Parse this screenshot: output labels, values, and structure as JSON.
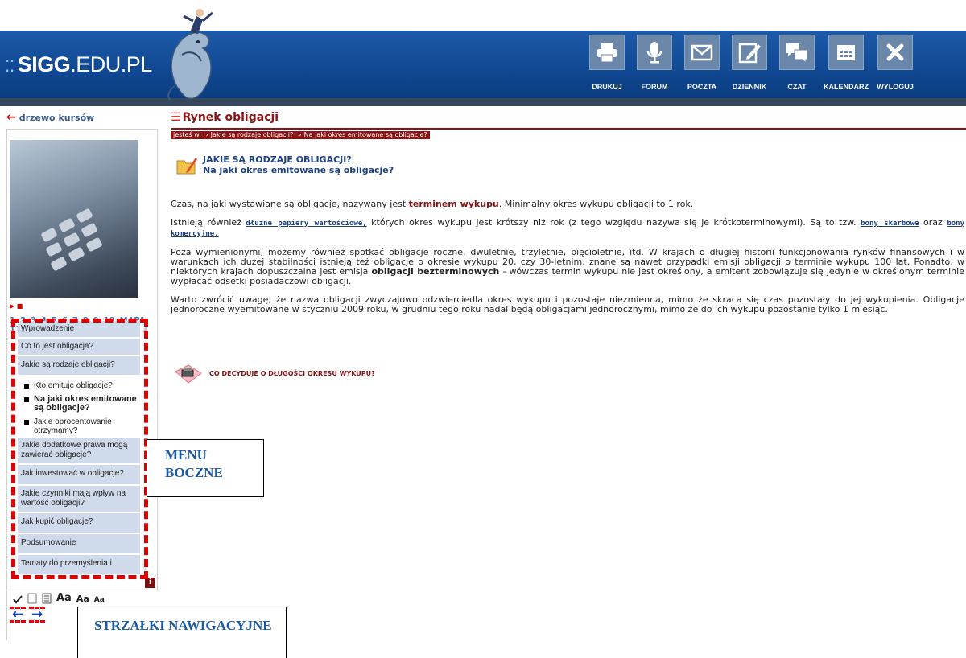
{
  "header": {
    "logo_text_bold": "SIGG",
    "logo_text_rest": ".EDU.PL",
    "nav": [
      {
        "label": "DRUKUJ",
        "icon": "printer-icon"
      },
      {
        "label": "FORUM",
        "icon": "microphone-icon"
      },
      {
        "label": "POCZTA",
        "icon": "mail-icon"
      },
      {
        "label": "DZIENNIK",
        "icon": "journal-edit-icon"
      },
      {
        "label": "CZAT",
        "icon": "chat-icon"
      },
      {
        "label": "KALENDARZ",
        "icon": "calendar-icon"
      },
      {
        "label": "WYLOGUJ",
        "icon": "close-icon"
      }
    ]
  },
  "sidebar": {
    "back_label": "drzewo kursów",
    "page_numbers": [
      "1",
      "2",
      "3",
      "4",
      "5",
      "6",
      "7",
      "8",
      "9",
      "10",
      "MAPA",
      "11"
    ],
    "menu": [
      {
        "label": "Wprowadzenie",
        "type": "item"
      },
      {
        "label": "Co to jest obligacja?",
        "type": "item"
      },
      {
        "label": "Jakie są rodzaje obligacji?",
        "type": "item"
      },
      {
        "label": "Kto emituje obligacje?",
        "type": "sub"
      },
      {
        "label": "Na jaki okres emitowane są obligacje?",
        "type": "sub-active"
      },
      {
        "label": "Jakie oprocentowanie otrzymamy?",
        "type": "sub"
      },
      {
        "label": "Jakie dodatkowe prawa mogą zawierać obligacje?",
        "type": "item"
      },
      {
        "label": "Jak inwestować w obligacje?",
        "type": "item"
      },
      {
        "label": "Jakie czynniki mają wpływ na wartość obligacji?",
        "type": "item"
      },
      {
        "label": "Jak kupić obligacje?",
        "type": "item"
      },
      {
        "label": "Podsumowanie",
        "type": "item"
      },
      {
        "label": "Tematy do przemyślenia i",
        "type": "item"
      }
    ],
    "font_sizes": [
      "Aa",
      "Aa",
      "Aa"
    ],
    "arrow_prev": "←",
    "arrow_next": "→"
  },
  "callouts": {
    "menu": "MENU BOCZNE",
    "arrows": "STRZAŁKI NAWIGACYJNE"
  },
  "main": {
    "title": "Rynek obligacji",
    "breadcrumb_prefix": "jesteś w:",
    "breadcrumb_1": "Jakie są rodzaje obligacji?",
    "breadcrumb_2": "Na jaki okres emitowane są obligacje?",
    "lesson_title_1": "JAKIE SĄ RODZAJE OBLIGACJI?",
    "lesson_title_2": "Na jaki okres emitowane są obligacje?",
    "p1_a": "Czas, na jaki wystawiane są obligacje, nazywany jest ",
    "p1_term": "terminem wykupu",
    "p1_b": ". Minimalny okres wykupu obligacji to 1 rok.",
    "p2_a": "Istnieją również ",
    "p2_link1": "dłużne papiery wartościowe,",
    "p2_b": " których okres wykupu jest krótszy niż rok (z tego względu nazywa się je krótkoterminowymi). Są to tzw. ",
    "p2_link2": "bony skarbowe",
    "p2_c": " oraz ",
    "p2_link3": "bony komercyjne.",
    "p3_a": "Poza wymienionymi, możemy również spotkać obligacje roczne, dwuletnie, trzyletnie, pięcioletnie, itd. W krajach o długiej historii funkcjonowania rynków finansowych i w warunkach ich dużej stabilności istnieją też obligacje o okresie wykupu 20, czy 30-letnim, znane są nawet przypadki emisji obligacji o terminie wykupu 100 lat. Ponadto, w niektórych krajach dopuszczalna jest emisja ",
    "p3_bold": "obligacji bezterminowych",
    "p3_b": " - wówczas termin wykupu nie jest określony, a emitent zobowiązuje się jedynie w określonym terminie wypłacać odsetki posiadaczowi obligacji.",
    "p4": "Warto zwrócić uwagę, że nazwa obligacji zwyczajowo odzwierciedla okres wykupu i pozostaje niezmienna, mimo że skraca się czas pozostały do jej wykupienia. Obligacje jednoroczne wyemitowane w styczniu 2009 roku, w grudniu tego roku nadal będą obligacjami jednorocznymi, mimo że do ich wykupu pozostanie tylko 1 miesiąc.",
    "next_topic": "CO DECYDUJE O DŁUGOŚCI OKRESU WYKUPU?"
  },
  "colors": {
    "header_blue": "#104892",
    "title_red": "#8a1414",
    "menu_blue": "#cfdaea",
    "annotation_red": "#e00000"
  }
}
